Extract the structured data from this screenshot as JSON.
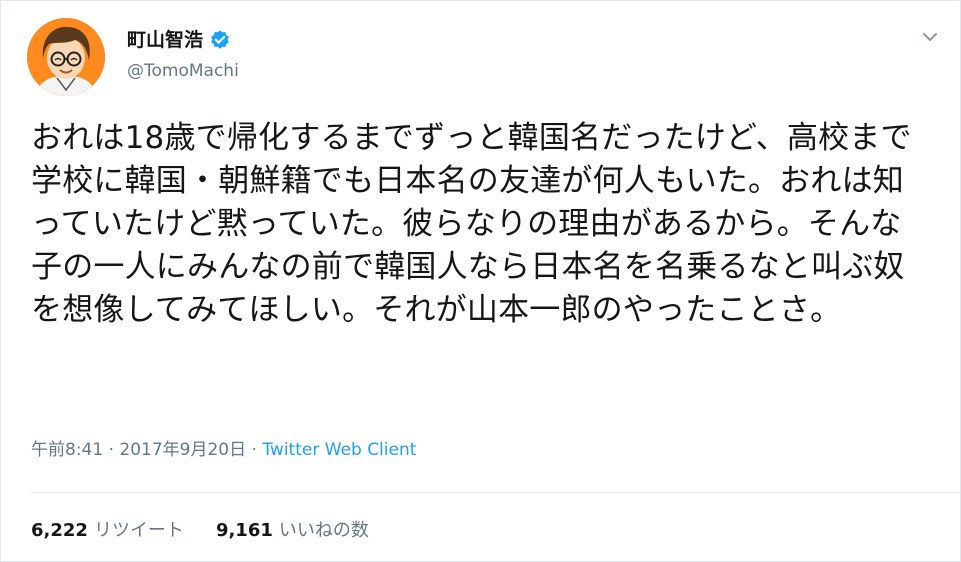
{
  "user": {
    "display_name": "町山智浩",
    "handle": "@TomoMachi",
    "verified": true
  },
  "tweet": {
    "text": "おれは18歳で帰化するまでずっと韓国名だったけど、高校まで学校に韓国・朝鮮籍でも日本名の友達が何人もいた。おれは知っていたけど黙っていた。彼らなりの理由があるから。そんな子の一人にみんなの前で韓国人なら日本名を名乗るなと叫ぶ奴を想像してみてほしい。それが山本一郎のやったことさ。",
    "time": "午前8:41",
    "separator": "·",
    "date": "2017年9月20日",
    "client": "Twitter Web Client"
  },
  "stats": {
    "retweets_count": "6,222",
    "retweets_label": "リツイート",
    "likes_count": "9,161",
    "likes_label": "いいねの数"
  },
  "colors": {
    "link": "#1da1f2",
    "muted": "#657786",
    "text": "#14171a",
    "avatar_bg": "#ff8a1f"
  },
  "icons": {
    "verified": "verified-badge-icon",
    "menu": "chevron-down-icon"
  }
}
